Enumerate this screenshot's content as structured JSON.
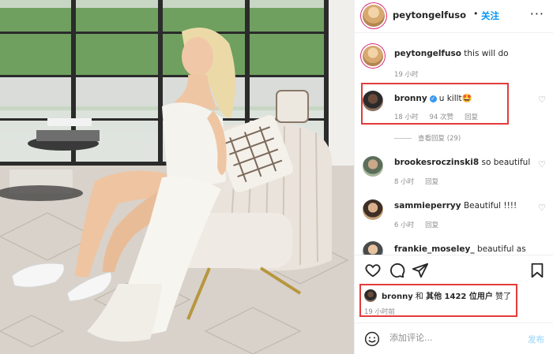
{
  "post": {
    "author": "peytongelfuso",
    "separator": "•",
    "follow_label": "关注",
    "more_label": "···",
    "caption_user": "peytongelfuso",
    "caption_text": "this will do",
    "caption_time": "19 小时"
  },
  "comments": [
    {
      "user": "bronny",
      "verified": true,
      "verified_mark": "✓",
      "text": "u killt🤩",
      "time": "18 小时",
      "likes": "94 次赞",
      "reply": "回复",
      "view_replies": "查看回复 (29)"
    },
    {
      "user": "brookesroczinski8",
      "text": "so beautiful",
      "time": "8 小时",
      "reply": "回复"
    },
    {
      "user": "sammieperryy",
      "text": "Beautiful !!!!",
      "time": "6 小时",
      "reply": "回复"
    },
    {
      "user": "frankie_moseley_",
      "text": "beautiful as"
    }
  ],
  "likes": {
    "user": "bronny",
    "text_mid": " 和 ",
    "text_bold": "其他 1422 位用户",
    "text_end": " 赞了",
    "time": "19 小时前"
  },
  "add_comment": {
    "placeholder": "添加评论...",
    "post_label": "发布"
  },
  "icons": [
    "heart-icon",
    "comment-icon",
    "share-icon",
    "bookmark-icon",
    "emoji-icon",
    "more-icon"
  ],
  "colors": {
    "follow": "#0095f6",
    "highlight_box": "#e33b3b",
    "verified": "#3897f0",
    "post_disabled": "#b2dffc"
  }
}
